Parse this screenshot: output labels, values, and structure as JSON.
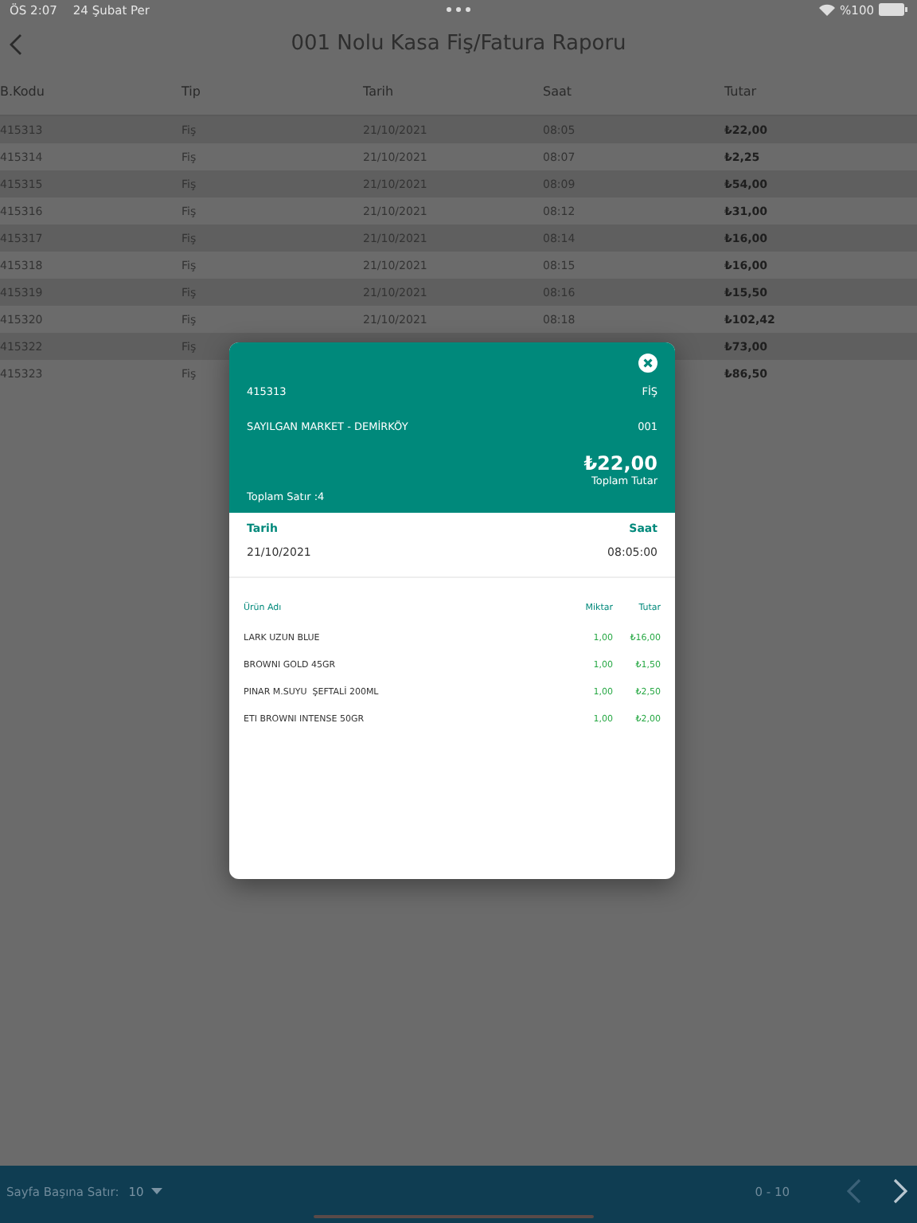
{
  "status_bar": {
    "time": "ÖS 2:07",
    "date": "24 Şubat Per",
    "battery": "%100"
  },
  "header": {
    "title": "001 Nolu Kasa Fiş/Fatura Raporu"
  },
  "table": {
    "columns": [
      "B.Kodu",
      "Tip",
      "Tarih",
      "Saat",
      "Tutar"
    ],
    "rows": [
      {
        "cells": [
          "415313",
          "Fiş",
          "21/10/2021",
          "08:05",
          "₺22,00"
        ]
      },
      {
        "cells": [
          "415314",
          "Fiş",
          "21/10/2021",
          "08:07",
          "₺2,25"
        ]
      },
      {
        "cells": [
          "415315",
          "Fiş",
          "21/10/2021",
          "08:09",
          "₺54,00"
        ]
      },
      {
        "cells": [
          "415316",
          "Fiş",
          "21/10/2021",
          "08:12",
          "₺31,00"
        ]
      },
      {
        "cells": [
          "415317",
          "Fiş",
          "21/10/2021",
          "08:14",
          "₺16,00"
        ]
      },
      {
        "cells": [
          "415318",
          "Fiş",
          "21/10/2021",
          "08:15",
          "₺16,00"
        ]
      },
      {
        "cells": [
          "415319",
          "Fiş",
          "21/10/2021",
          "08:16",
          "₺15,50"
        ]
      },
      {
        "cells": [
          "415320",
          "Fiş",
          "21/10/2021",
          "08:18",
          "₺102,42"
        ]
      },
      {
        "cells": [
          "415322",
          "Fiş",
          null,
          null,
          "₺73,00"
        ]
      },
      {
        "cells": [
          "415323",
          "Fiş",
          null,
          null,
          "₺86,50"
        ]
      }
    ]
  },
  "dialog": {
    "code": "415313",
    "type": "FİŞ",
    "customer": "SAYILGAN MARKET - DEMİRKÖY",
    "register": "001",
    "total": "₺22,00",
    "total_label": "Toplam Tutar",
    "line_count": "Toplam Satır :4",
    "date_label": "Tarih",
    "date": "21/10/2021",
    "time_label": "Saat",
    "time": "08:05:00",
    "columns": [
      "Ürün Adı",
      "Miktar",
      "Tutar"
    ],
    "items": [
      {
        "name": "LARK UZUN BLUE",
        "qty": "1,00",
        "amount": "₺16,00"
      },
      {
        "name": "BROWNI GOLD 45GR",
        "qty": "1,00",
        "amount": "₺1,50"
      },
      {
        "name": "PINAR M.SUYU  ŞEFTALİ 200ML",
        "qty": "1,00",
        "amount": "₺2,50"
      },
      {
        "name": "ETI BROWNI INTENSE 50GR",
        "qty": "1,00",
        "amount": "₺2,00"
      }
    ]
  },
  "footer": {
    "rows_label": "Sayfa Başına Satır:",
    "rows_value": "10",
    "range": "0 - 10",
    "prev_disabled": true,
    "next_disabled": false
  }
}
